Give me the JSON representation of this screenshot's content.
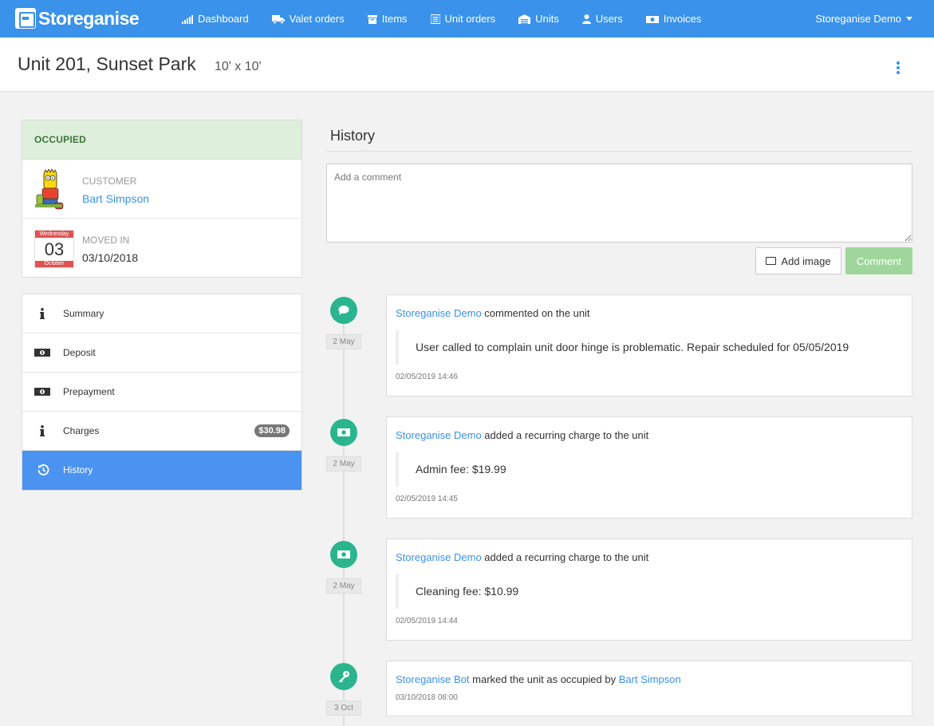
{
  "nav": {
    "brand": "Storeganise",
    "items": [
      {
        "label": "Dashboard",
        "icon": "bar-chart-icon"
      },
      {
        "label": "Valet orders",
        "icon": "truck-icon"
      },
      {
        "label": "Items",
        "icon": "archive-box-icon"
      },
      {
        "label": "Unit orders",
        "icon": "list-icon"
      },
      {
        "label": "Units",
        "icon": "warehouse-icon"
      },
      {
        "label": "Users",
        "icon": "user-icon"
      },
      {
        "label": "Invoices",
        "icon": "money-icon"
      }
    ],
    "user": "Storeganise Demo"
  },
  "header": {
    "title": "Unit 201, Sunset Park",
    "size": "10' x 10'"
  },
  "status_card": {
    "status": "OCCUPIED",
    "customer_label": "CUSTOMER",
    "customer_name": "Bart Simpson",
    "moved_in_label": "MOVED IN",
    "moved_in_date": "03/10/2018",
    "calendar": {
      "weekday": "Wednesday",
      "day": "03",
      "month": "October"
    }
  },
  "menu": {
    "items": [
      {
        "label": "Summary",
        "icon": "info-icon"
      },
      {
        "label": "Deposit",
        "icon": "money-icon"
      },
      {
        "label": "Prepayment",
        "icon": "money-icon"
      },
      {
        "label": "Charges",
        "icon": "info-icon",
        "badge": "$30.98"
      },
      {
        "label": "History",
        "icon": "history-icon",
        "active": true
      }
    ]
  },
  "history": {
    "title": "History",
    "comment_placeholder": "Add a comment",
    "add_image_label": "Add image",
    "comment_button_label": "Comment",
    "entries": [
      {
        "icon": "comment-icon",
        "date_tag": "2 May",
        "actor": "Storeganise Demo",
        "action": "commented on the unit",
        "detail": "User called to complain unit door hinge is problematic. Repair scheduled for 05/05/2019",
        "timestamp": "02/05/2019 14:46"
      },
      {
        "icon": "money-icon",
        "date_tag": "2 May",
        "actor": "Storeganise Demo",
        "action": "added a recurring charge to the unit",
        "detail": "Admin fee: $19.99",
        "timestamp": "02/05/2019 14:45"
      },
      {
        "icon": "money-icon",
        "date_tag": "2 May",
        "actor": "Storeganise Demo",
        "action": "added a recurring charge to the unit",
        "detail": "Cleaning fee: $10.99",
        "timestamp": "02/05/2019 14:44"
      },
      {
        "icon": "key-icon",
        "date_tag": "3 Oct",
        "actor": "Storeganise Bot",
        "action": "marked the unit as occupied by",
        "target": "Bart Simpson",
        "timestamp": "03/10/2018 08:00"
      }
    ]
  },
  "colors": {
    "primary": "#3a92ea",
    "success_bg": "#deefdc",
    "success_text": "#3c763d",
    "timeline": "#2bb58e",
    "active_menu": "#4a93f0",
    "comment_button": "#9fd69b"
  }
}
